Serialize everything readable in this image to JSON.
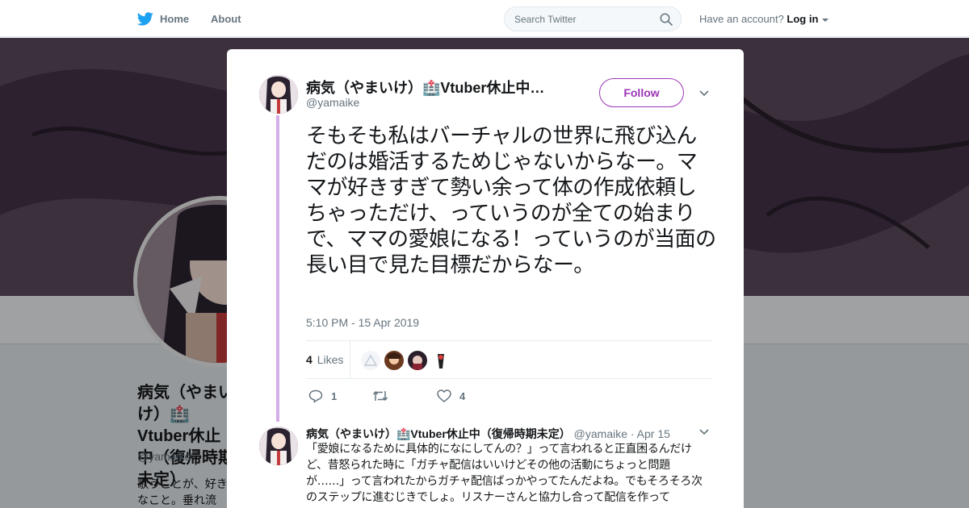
{
  "nav": {
    "home_label": "Home",
    "about_label": "About",
    "search_placeholder": "Search Twitter",
    "account_prompt": "Have an account?",
    "login_label": "Log in"
  },
  "background_profile": {
    "name": "病気（やまいけ）🏥Vtuber休止中（復帰時期未定）",
    "handle": "@yamaike",
    "bio": "歌うことが、好きなこと。垂れ流し。"
  },
  "tweet": {
    "display_name": "病気（やまいけ）🏥Vtuber休止中…",
    "handle": "@yamaike",
    "follow_label": "Follow",
    "text": "そもそも私はバーチャルの世界に飛び込んだのは婚活するためじゃないからなー。ママが好きすぎて勢い余って体の作成依頼しちゃっただけ、っていうのが全ての始まりで、ママの愛娘になる！っていうのが当面の長い目で見た目標だからなー。",
    "timestamp": "5:10 PM - 15 Apr 2019",
    "likes_count": "4",
    "likes_label": "Likes",
    "reply_count": "1",
    "retweet_count": "",
    "like_count": "4"
  },
  "reply": {
    "display_name": "病気（やまいけ）🏥Vtuber休止中（復帰時期未定）",
    "handle": "@yamaike",
    "date": "· Apr 15",
    "text": "「愛娘になるために具体的になにしてんの？」って言われると正直困るんだけど、昔怒られた時に「ガチャ配信はいいけどその他の活動にちょっと問題が……」って言われたからガチャ配信ばっかやってたんだよね。でもそろそろ次のステップに進むじきでしょ。リスナーさんと協力し合って配信を作って"
  },
  "colors": {
    "twitter_blue": "#1da1f2",
    "follow_purple": "#9c36b5",
    "thread_line": "#d4aee6",
    "muted_text": "#66757f"
  }
}
